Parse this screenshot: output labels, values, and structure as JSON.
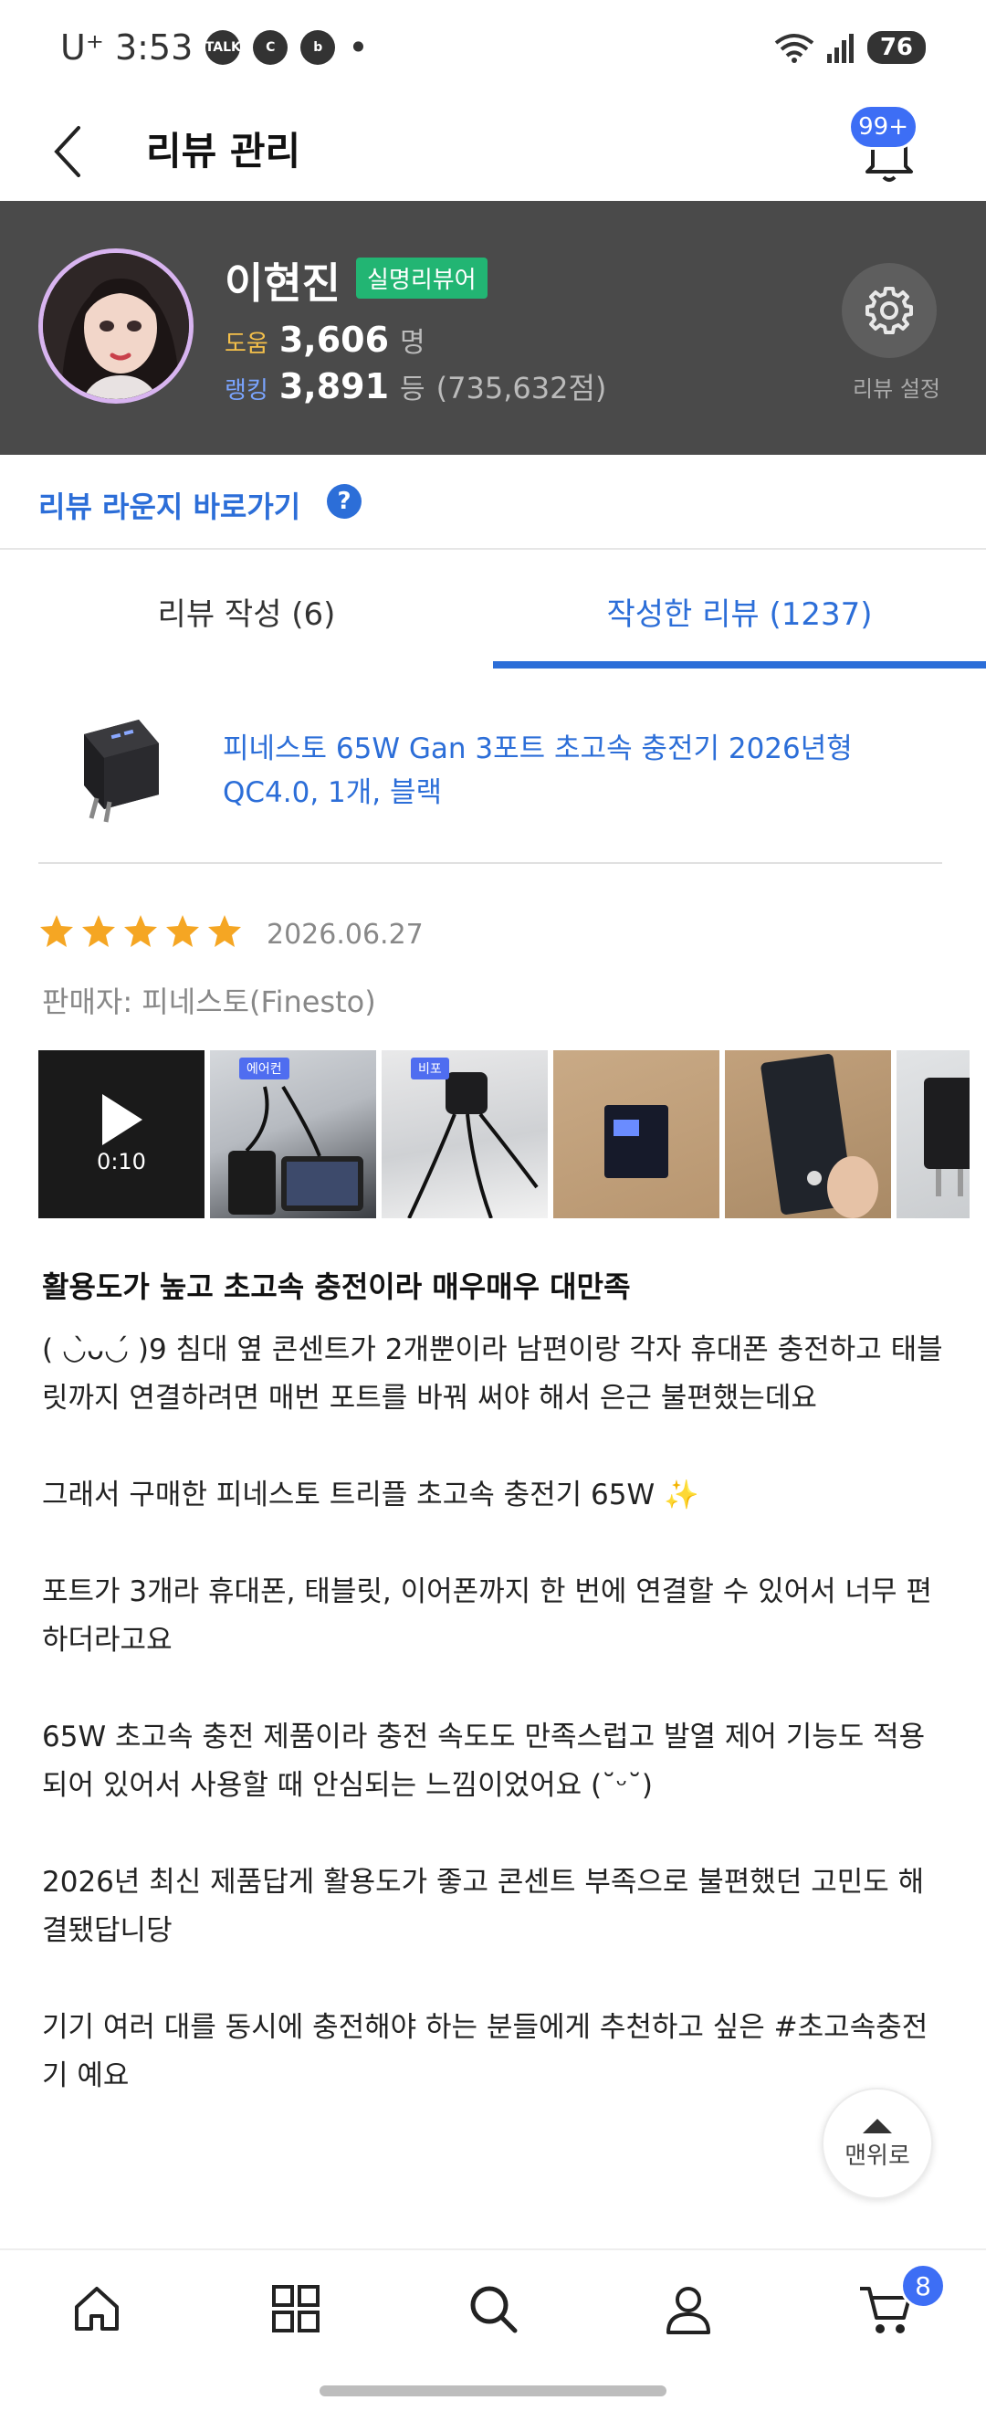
{
  "status_bar": {
    "time": "U⁺ 3:53",
    "chips": [
      "TALK",
      "C",
      "b"
    ],
    "dot": "•",
    "battery": "76"
  },
  "header": {
    "title": "리뷰 관리",
    "bell_badge": "99+"
  },
  "profile": {
    "name": "이현진",
    "badge": "실명리뷰어",
    "help_label": "도움",
    "help_value": "3,606",
    "help_unit": "명",
    "rank_label": "랭킹",
    "rank_value": "3,891",
    "rank_unit": "등",
    "rank_score": "(735,632점)",
    "settings_label": "리뷰 설정"
  },
  "lounge": {
    "link": "리뷰 라운지 바로가기",
    "help": "?"
  },
  "tabs": {
    "write": "리뷰 작성 (6)",
    "written": "작성한 리뷰 (1237)"
  },
  "product": {
    "title": "피네스토 65W Gan 3포트 초고속 충전기 2026년형 QC4.0, 1개, 블랙"
  },
  "review": {
    "rating": 5,
    "date": "2026.06.27",
    "seller": "판매자: 피네스토(Finesto)",
    "video_time": "0:10",
    "photo_tags": [
      "에어컨",
      "비포"
    ],
    "title": "활용도가 높고 초고속 충전이라 매우매우 대만족",
    "body": "( ◡̀ᴗ◡́ )9 침대 옆 콘센트가 2개뿐이라 남편이랑 각자 휴대폰 충전하고 태블릿까지 연결하려면 매번 포트를 바꿔 써야 해서 은근 불편했는데요\n\n그래서 구매한 피네스토 트리플 초고속 충전기 65W ✨\n\n포트가 3개라 휴대폰, 태블릿, 이어폰까지 한 번에 연결할 수 있어서 너무 편하더라고요\n\n65W 초고속 충전 제품이라 충전 속도도 만족스럽고 발열 제어 기능도 적용되어 있어서 사용할 때 안심되는 느낌이었어요 (˘ᵕ˘)\n\n2026년 최신 제품답게 활용도가 좋고 콘센트 부족으로 불편했던 고민도 해결됐답니당\n\n기기 여러 대를 동시에 충전해야 하는 분들에게 추천하고 싶은 #초고속충전기 예요"
  },
  "scroll_top": {
    "label": "맨위로"
  },
  "bottom_nav": {
    "cart_badge": "8"
  },
  "colors": {
    "accent": "#2c6ed8",
    "badge_blue": "#3d6ef5",
    "profile_bg": "#4a4a4a",
    "real_name_badge": "#22b573",
    "star": "#f5a623"
  },
  "icons": [
    "back-arrow-icon",
    "bell-icon",
    "gear-icon",
    "question-icon",
    "star-icon",
    "play-icon",
    "chevron-up-icon",
    "home-icon",
    "grid-icon",
    "search-icon",
    "user-icon",
    "cart-icon"
  ]
}
